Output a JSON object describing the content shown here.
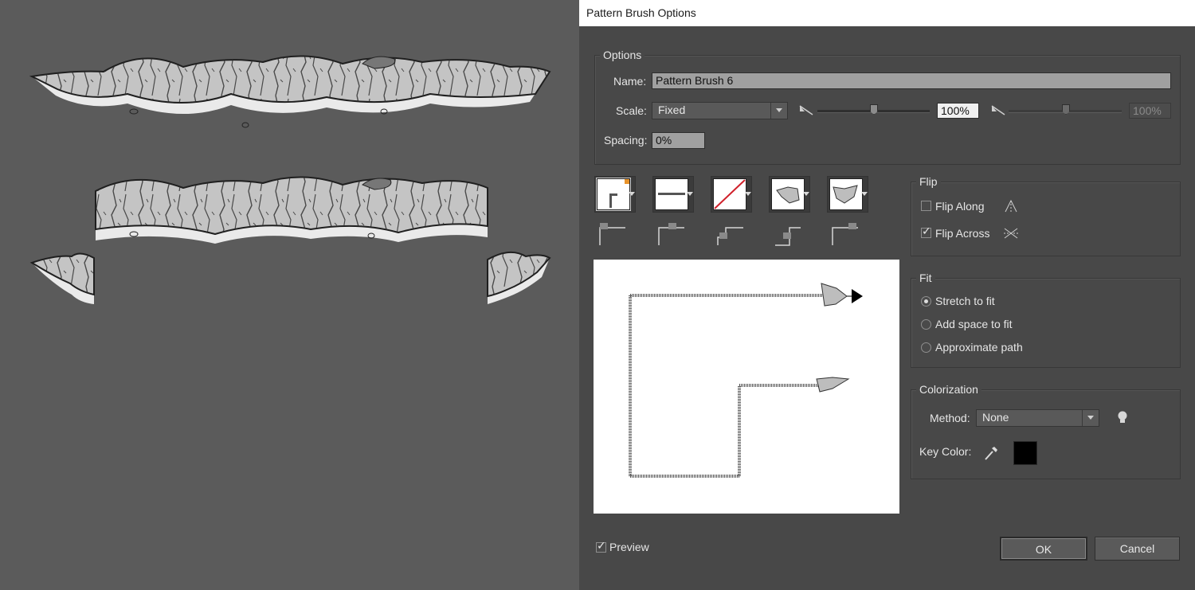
{
  "dialog": {
    "title": "Pattern Brush Options",
    "options": {
      "group_title": "Options",
      "name_label": "Name:",
      "name_value": "Pattern Brush 6",
      "scale_label": "Scale:",
      "scale_value": "Fixed",
      "scale_percent": "100%",
      "scale_percent_disabled": "100%",
      "spacing_label": "Spacing:",
      "spacing_value": "0%"
    },
    "tiles": [
      {
        "name": "side-tile"
      },
      {
        "name": "outer-corner-tile"
      },
      {
        "name": "inner-corner-tile"
      },
      {
        "name": "start-tile"
      },
      {
        "name": "end-tile"
      }
    ],
    "flip": {
      "group_title": "Flip",
      "flip_along": "Flip Along",
      "flip_along_checked": false,
      "flip_across": "Flip Across",
      "flip_across_checked": true
    },
    "fit": {
      "group_title": "Fit",
      "stretch": "Stretch to fit",
      "add_space": "Add space to fit",
      "approximate": "Approximate path",
      "selected": "Stretch to fit"
    },
    "colorization": {
      "group_title": "Colorization",
      "method_label": "Method:",
      "method_value": "None",
      "key_color_label": "Key Color:",
      "key_color": "#000000"
    },
    "preview": {
      "label": "Preview",
      "checked": true
    },
    "buttons": {
      "ok": "OK",
      "cancel": "Cancel"
    }
  },
  "colors": {
    "canvas_bg": "#5b5b5b",
    "dialog_bg": "#484848",
    "tile_corner_accent": "#e8932a",
    "none_slash": "#d0202a"
  }
}
